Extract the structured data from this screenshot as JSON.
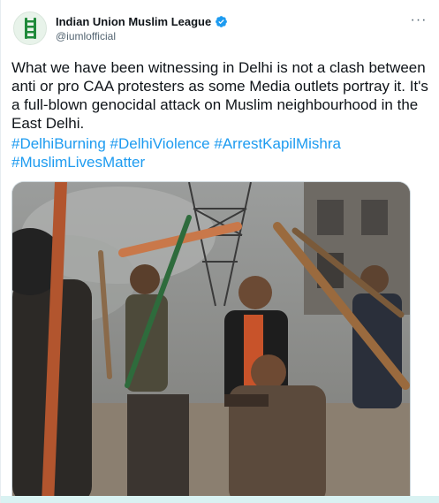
{
  "account": {
    "display_name": "Indian Union Muslim League",
    "handle": "@iumlofficial",
    "verified_icon": "verified-badge-icon",
    "avatar_icon": "ladder-logo-icon"
  },
  "menu": {
    "more_label": "···"
  },
  "tweet": {
    "text": "What we have been witnessing in Delhi is not a clash between anti or pro CAA protesters as some Media outlets portray it. It's a full-blown genocidal attack on Muslim neighbourhood in the East Delhi.",
    "hashtags": [
      "#DelhiBurning",
      "#DelhiViolence",
      "#ArrestKapilMishra",
      "#MuslimLivesMatter"
    ]
  },
  "colors": {
    "link": "#1d9bf0",
    "verified": "#1d9bf0",
    "text": "#0f1419",
    "secondary": "#536471",
    "logo_green": "#1f8a3a"
  }
}
